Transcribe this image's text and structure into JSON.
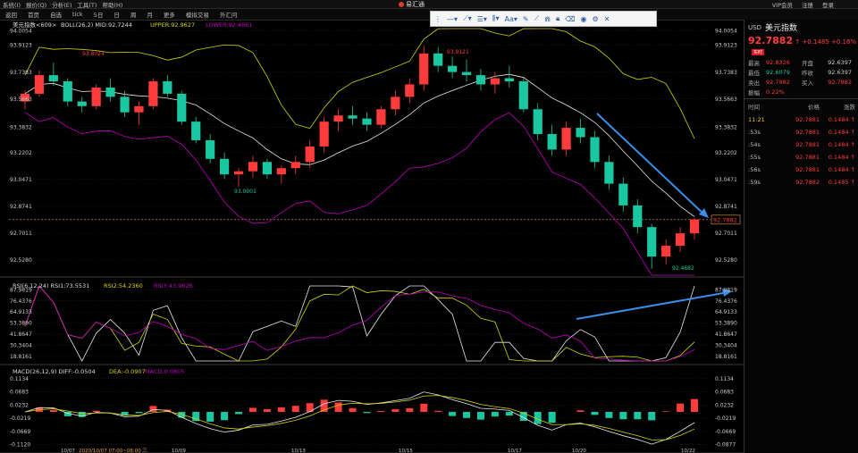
{
  "topmenu": [
    "系统(I)",
    "报价(Q)",
    "分析(E)",
    "工具(T)",
    "帮助(H)"
  ],
  "app_title": "易汇通",
  "topright": [
    "VIP会员",
    "注册",
    "登录"
  ],
  "toolbar": [
    "返回",
    "首页",
    "自选",
    "tick",
    "5日",
    "日",
    "周",
    "月",
    "更多",
    "模拟交易",
    "外汇问"
  ],
  "indicator_labels": {
    "main": "美元指数<609>",
    "boll": "BOLL(26,2) MID:92.7244",
    "upper": "UPPER:92.9627",
    "lower": "LOWER:92.4861",
    "rsi": "RSI(6,12,24) RSI1:73.5531",
    "rsi2": "RSI2:54.2360",
    "rsi3": "RSI3:43.9626",
    "macd": "MACD(26,12,9) DIFF:-0.0504",
    "dea": "DEA:-0.0907",
    "macdv": "MACD:0.0805"
  },
  "colors": {
    "up": "#ff3b3b",
    "down": "#19c8a0",
    "boll_mid": "#e8e8e8",
    "boll_upper": "#d4d400",
    "boll_lower": "#c000c0",
    "arrow": "#3a8ee8",
    "grid": "#2b2b2b"
  },
  "price_axis": [
    "94.0054",
    "93.9123",
    "93.7383",
    "93.5663",
    "93.3832",
    "93.2202",
    "93.0471",
    "92.8741",
    "92.7011",
    "92.5280"
  ],
  "current_price_tag": "92.7882",
  "rsi_axis": [
    "87.9819",
    "76.4376",
    "64.9133",
    "53.3890",
    "41.8647",
    "30.3404",
    "18.8161"
  ],
  "macd_axis": [
    "0.1134",
    "0.0683",
    "0.0232",
    "-0.0219",
    "-0.0669",
    "-0.1120"
  ],
  "macd_axis_right": [
    "0.1134",
    "0.0683",
    "0.0232",
    "-0.0219",
    "-0.0669",
    "-0.0877"
  ],
  "date_axis": [
    "10/07",
    "2020/10/07 07:00~08:00 三",
    "10/09",
    "10/13",
    "10/15",
    "10/17",
    "10/20",
    "10/22"
  ],
  "annotations": {
    "high1": "93.8024",
    "high2": "93.9121",
    "low1": "93.0001",
    "low2": "92.4682"
  },
  "chart_data": {
    "type": "candlestick",
    "title": "美元指数",
    "ylim": [
      92.43,
      94.02
    ],
    "candles": [
      [
        93.55,
        93.62,
        93.5,
        93.6
      ],
      [
        93.6,
        93.75,
        93.58,
        93.72
      ],
      [
        93.72,
        93.8,
        93.65,
        93.68
      ],
      [
        93.68,
        93.7,
        93.52,
        93.55
      ],
      [
        93.55,
        93.58,
        93.48,
        93.52
      ],
      [
        93.52,
        93.66,
        93.5,
        93.64
      ],
      [
        93.64,
        93.7,
        93.55,
        93.58
      ],
      [
        93.58,
        93.62,
        93.45,
        93.48
      ],
      [
        93.48,
        93.55,
        93.4,
        93.52
      ],
      [
        93.52,
        93.7,
        93.5,
        93.68
      ],
      [
        93.68,
        93.72,
        93.58,
        93.6
      ],
      [
        93.6,
        93.62,
        93.4,
        93.42
      ],
      [
        93.42,
        93.45,
        93.28,
        93.3
      ],
      [
        93.3,
        93.34,
        93.15,
        93.18
      ],
      [
        93.18,
        93.22,
        93.05,
        93.08
      ],
      [
        93.08,
        93.12,
        93.0,
        93.1
      ],
      [
        93.1,
        93.2,
        93.06,
        93.16
      ],
      [
        93.16,
        93.18,
        93.05,
        93.08
      ],
      [
        93.08,
        93.14,
        93.02,
        93.12
      ],
      [
        93.12,
        93.2,
        93.08,
        93.16
      ],
      [
        93.16,
        93.3,
        93.12,
        93.26
      ],
      [
        93.26,
        93.45,
        93.22,
        93.42
      ],
      [
        93.42,
        93.5,
        93.36,
        93.46
      ],
      [
        93.46,
        93.52,
        93.4,
        93.44
      ],
      [
        93.44,
        93.48,
        93.36,
        93.4
      ],
      [
        93.4,
        93.52,
        93.38,
        93.5
      ],
      [
        93.5,
        93.62,
        93.46,
        93.58
      ],
      [
        93.58,
        93.7,
        93.54,
        93.66
      ],
      [
        93.66,
        93.91,
        93.62,
        93.86
      ],
      [
        93.86,
        93.9,
        93.74,
        93.78
      ],
      [
        93.78,
        93.84,
        93.7,
        93.74
      ],
      [
        93.74,
        93.82,
        93.68,
        93.72
      ],
      [
        93.72,
        93.76,
        93.62,
        93.66
      ],
      [
        93.66,
        93.74,
        93.6,
        93.7
      ],
      [
        93.7,
        93.78,
        93.64,
        93.68
      ],
      [
        93.68,
        93.7,
        93.48,
        93.5
      ],
      [
        93.5,
        93.54,
        93.3,
        93.34
      ],
      [
        93.34,
        93.4,
        93.2,
        93.24
      ],
      [
        93.24,
        93.42,
        93.2,
        93.38
      ],
      [
        93.38,
        93.44,
        93.28,
        93.32
      ],
      [
        93.32,
        93.36,
        93.12,
        93.16
      ],
      [
        93.16,
        93.2,
        92.98,
        93.02
      ],
      [
        93.02,
        93.06,
        92.84,
        92.88
      ],
      [
        92.88,
        92.92,
        92.7,
        92.74
      ],
      [
        92.74,
        92.76,
        92.47,
        92.55
      ],
      [
        92.55,
        92.66,
        92.5,
        92.62
      ],
      [
        92.62,
        92.74,
        92.58,
        92.7
      ],
      [
        92.7,
        92.8,
        92.66,
        92.79
      ]
    ],
    "rsi_ylim": [
      14,
      92
    ],
    "macd_ylim": [
      -0.125,
      0.125
    ]
  }
}
